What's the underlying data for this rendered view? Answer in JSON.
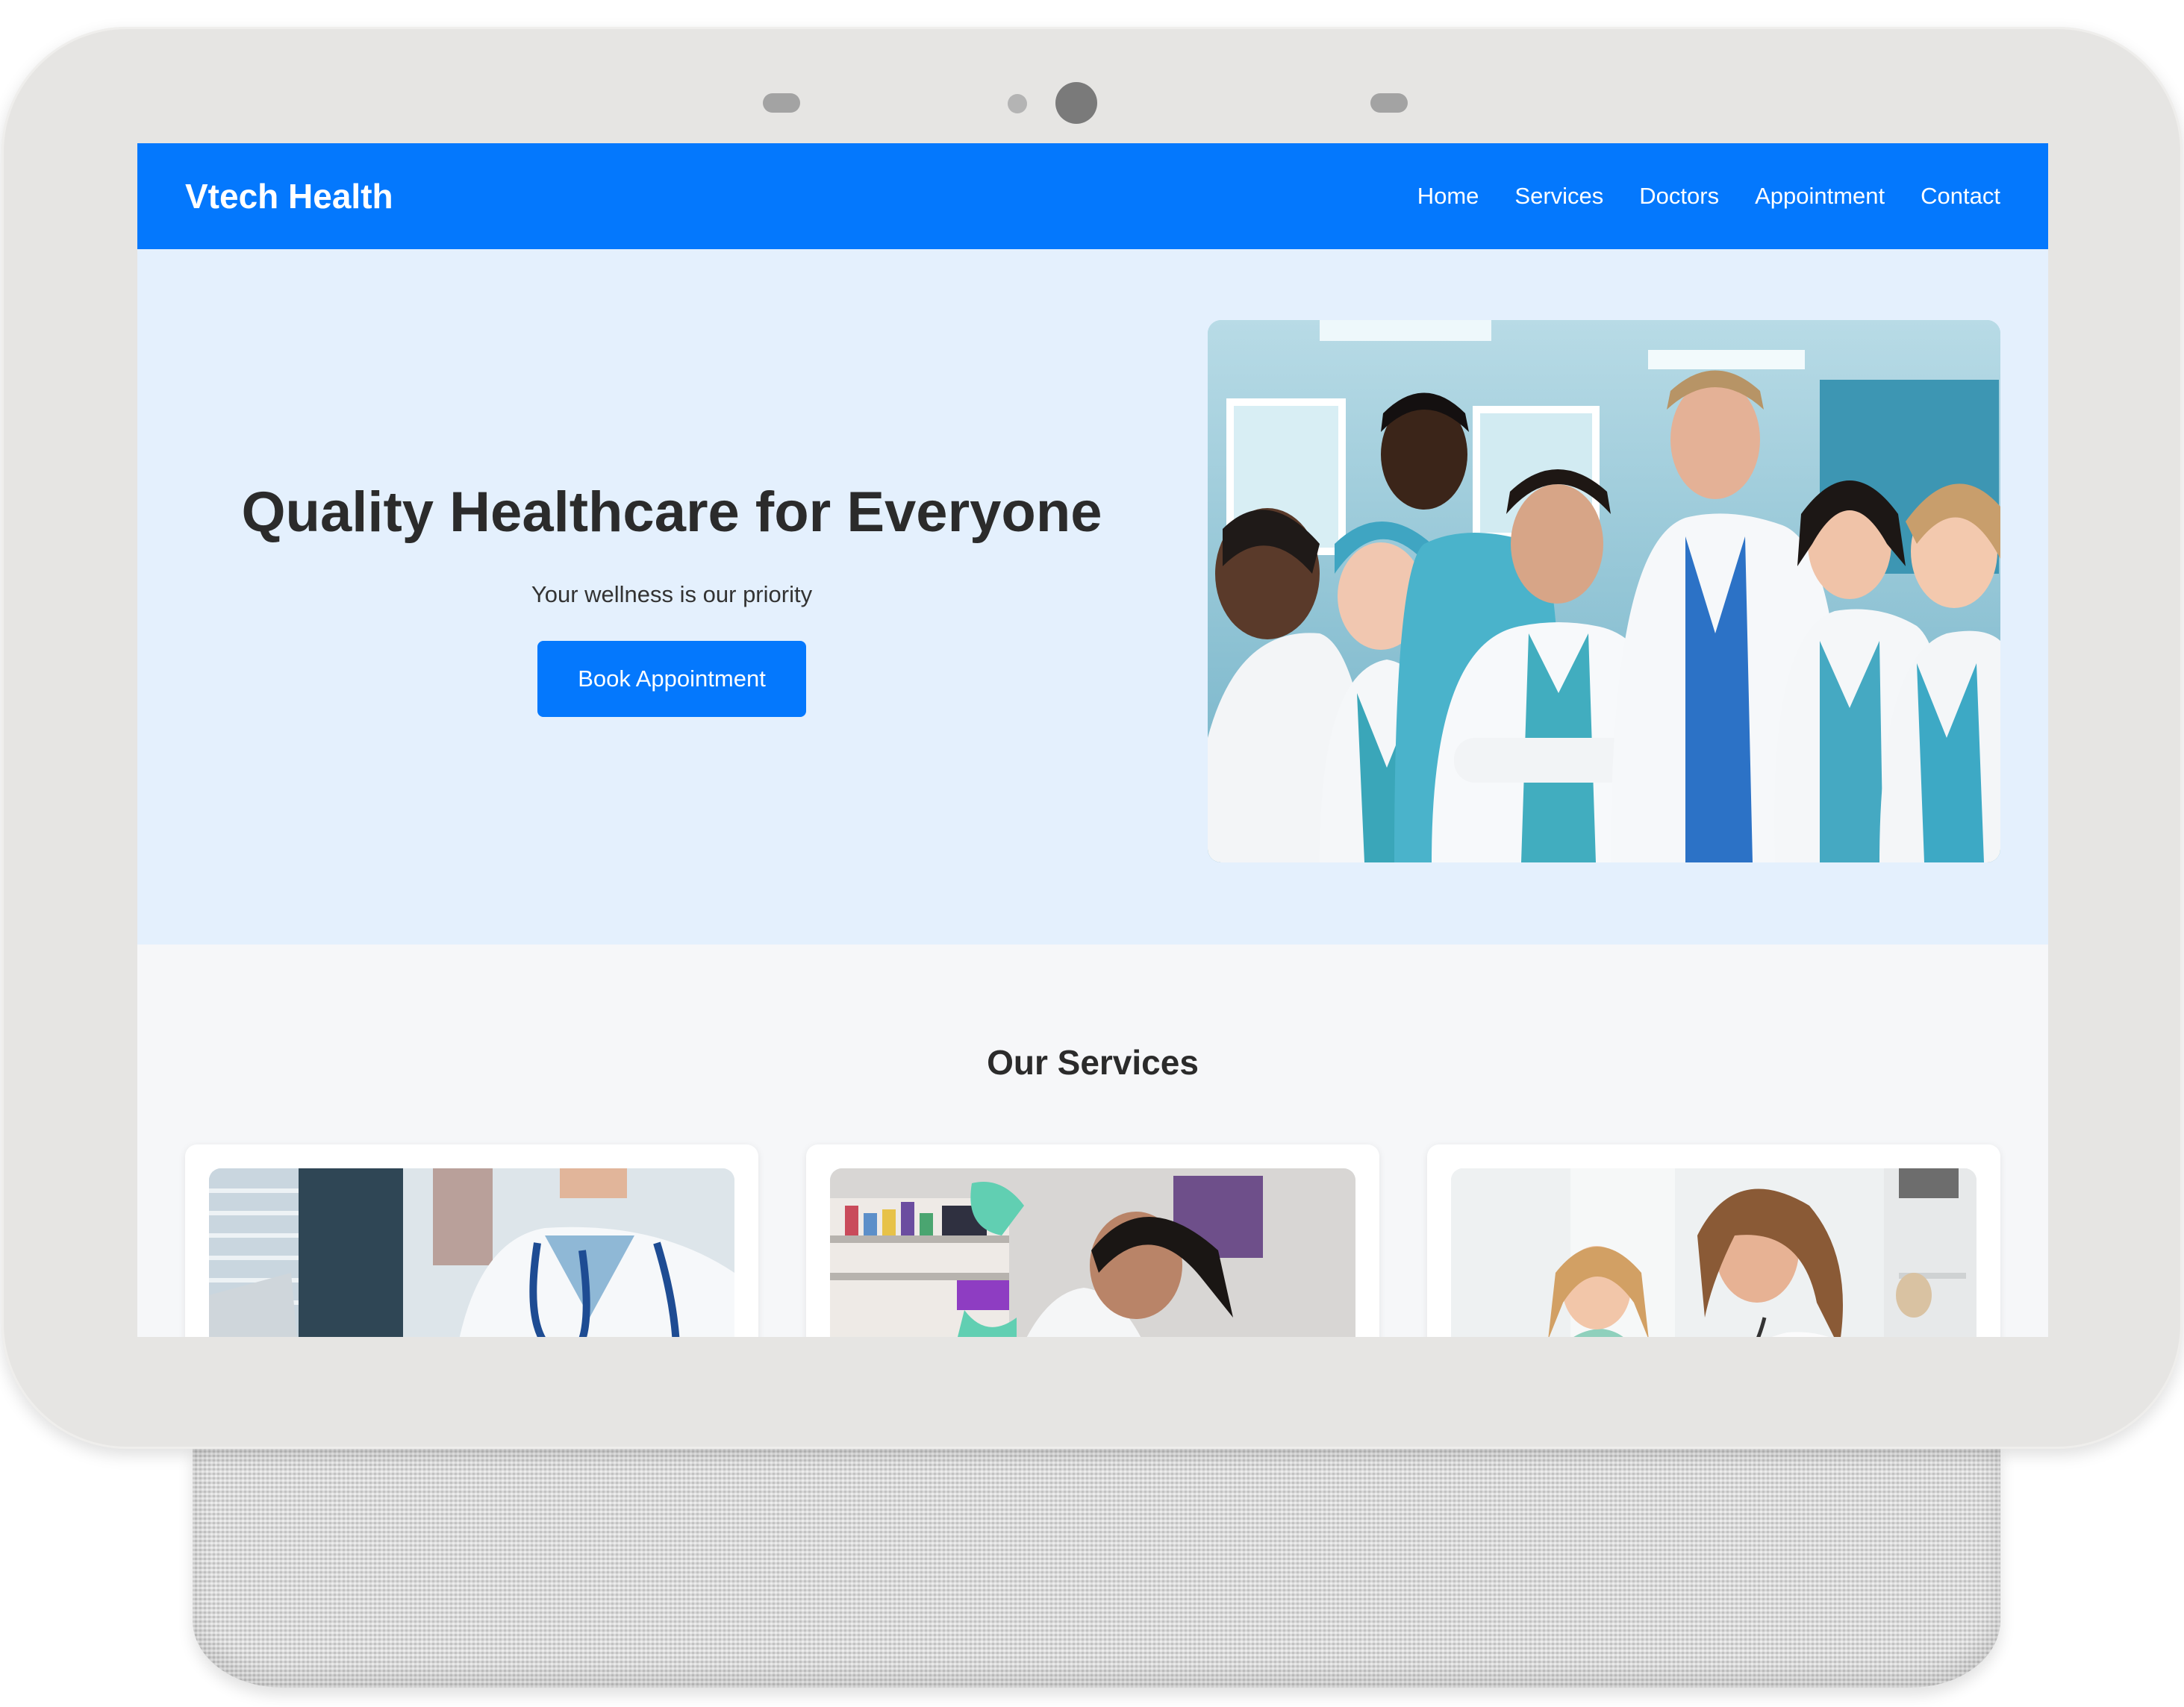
{
  "brand": "Vtech Health",
  "nav": {
    "links": [
      "Home",
      "Services",
      "Doctors",
      "Appointment",
      "Contact"
    ]
  },
  "hero": {
    "title": "Quality Healthcare for Everyone",
    "subtitle": "Your wellness is our priority",
    "cta_label": "Book Appointment"
  },
  "services": {
    "title": "Our Services"
  },
  "colors": {
    "primary": "#0478fd",
    "hero_background": "#e4f0fd",
    "section_background": "#f6f7f9",
    "heading_text": "#2b2b2b"
  }
}
